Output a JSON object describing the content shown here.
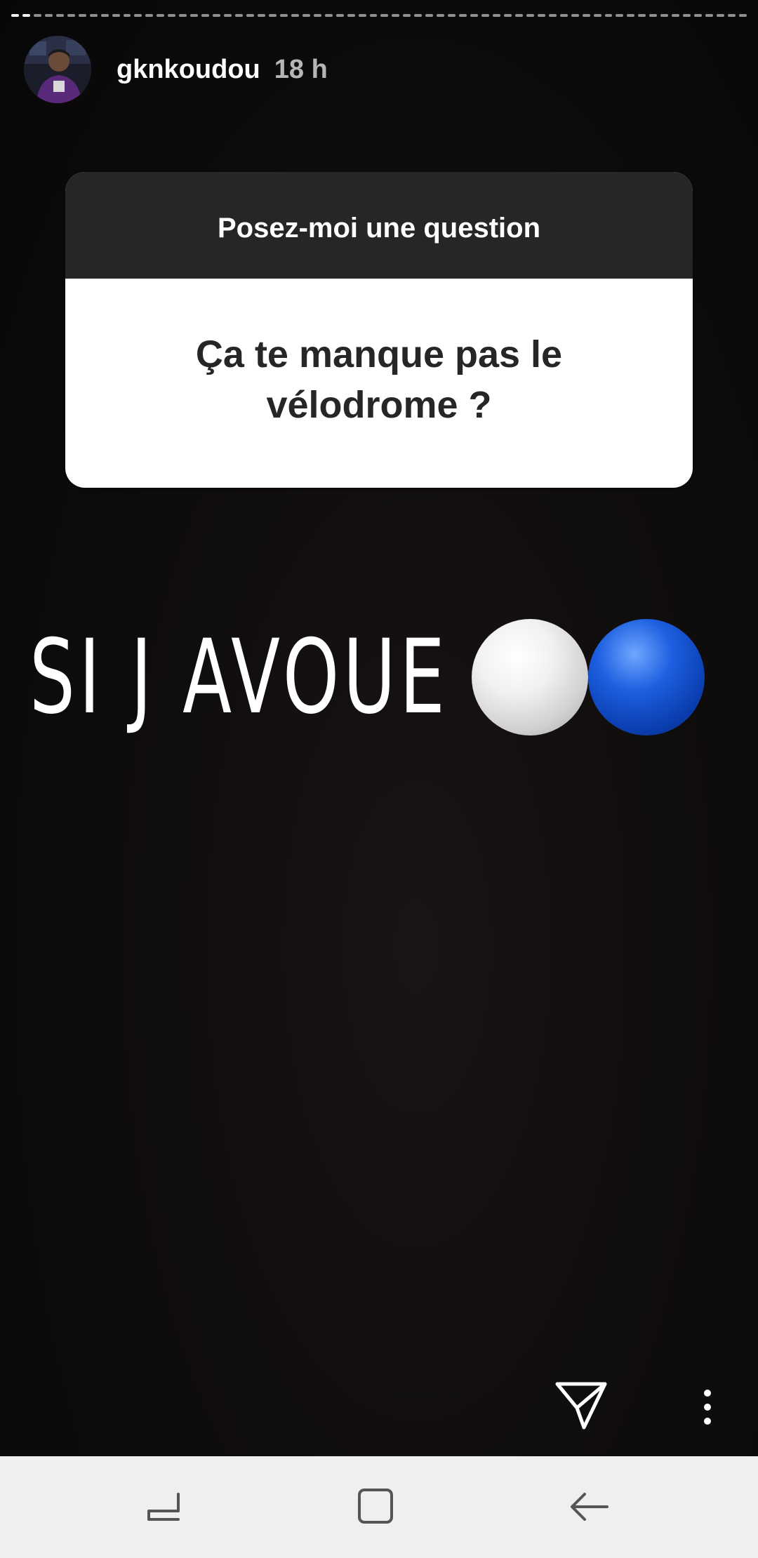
{
  "story": {
    "progress_segments": 66,
    "segments_viewed": 2,
    "header": {
      "username": "gknkoudou",
      "time": "18 h"
    },
    "question_sticker": {
      "prompt": "Posez-moi une question",
      "question": "Ça te manque pas le vélodrome ?"
    },
    "caption": {
      "text": "SI J AVOUE",
      "emoji": [
        "white-circle",
        "blue-circle"
      ]
    },
    "controls": {
      "send_icon": "paper-plane-icon",
      "more_icon": "vertical-dots-icon"
    }
  },
  "navbar": {
    "buttons": [
      "recent-apps-icon",
      "home-icon",
      "back-icon"
    ],
    "background": "#efefef"
  },
  "colors": {
    "story_bg": "#0d0b0b",
    "sticker_header": "#262626",
    "blue_emoji": "#1c5fe0"
  }
}
